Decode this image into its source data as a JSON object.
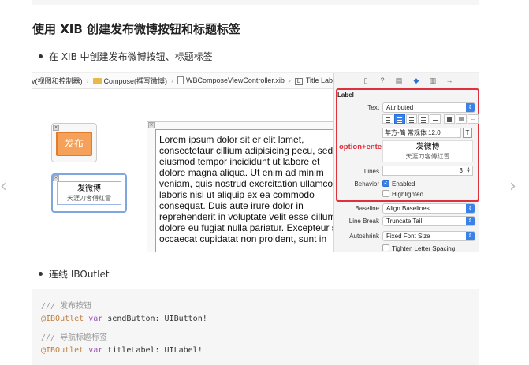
{
  "heading": "使用 XIB 创建发布微博按钮和标题标签",
  "bullet1": "在 XIB 中创建发布微博按钮、标题标签",
  "bullet2": "连线 IBOutlet",
  "nav": {
    "prev": "‹",
    "next": "›"
  },
  "jumpbar": {
    "group": "v(视图和控制器)",
    "folder": "Compose(撰写微博)",
    "file": "WBComposeViewController.xib",
    "icon_letter": "L",
    "item": "Title Label"
  },
  "canvas": {
    "send_button_label": "发布",
    "title_main": "发微博",
    "title_sub": "天涯刀客傅红雪",
    "lorem": "Lorem ipsum dolor sit er elit lamet,\nconsectetaur cillium adipisicing pecu, sed do\neiusmod tempor incididunt ut labore et\ndolore magna aliqua. Ut enim ad minim\nveniam, quis nostrud exercitation ullamco\nlaboris nisi ut aliquip ex ea commodo\nconsequat. Duis aute irure dolor in\nreprehenderit in voluptate velit esse cillum\ndolore eu fugiat nulla pariatur. Excepteur sint\noccaecat cupidatat non proident, sunt in"
  },
  "inspector": {
    "section": "Label",
    "text_label": "Text",
    "text_value": "Attributed",
    "font_value": "苹方-简 常规体 12.0",
    "font_icon": "T",
    "option_enter": "option+enter",
    "preview_main": "发微博",
    "preview_sub": "天涯刀客傅红雪",
    "lines_label": "Lines",
    "lines_value": "3",
    "behavior_label": "Behavior",
    "enabled_label": "Enabled",
    "highlighted_label": "Highlighted",
    "baseline_label": "Baseline",
    "baseline_value": "Align Baselines",
    "linebreak_label": "Line Break",
    "linebreak_value": "Truncate Tail",
    "autoshrink_label": "Autoshrink",
    "autoshrink_value": "Fixed Font Size",
    "tighten_label": "Tighten Letter Spacing",
    "align_more": "..."
  },
  "code": {
    "line1": "/// 发布按钮",
    "line2_attr": "@IBOutlet",
    "line2_kw": "var",
    "line2_rest": " sendButton: UIButton!",
    "line3": "/// 导航标题标签",
    "line4_attr": "@IBOutlet",
    "line4_kw": "var",
    "line4_rest": " titleLabel: UILabel!"
  },
  "colors": {
    "highlight_red": "#e0303b",
    "accent_blue": "#3b82e8",
    "button_orange": "#f5a15a"
  }
}
